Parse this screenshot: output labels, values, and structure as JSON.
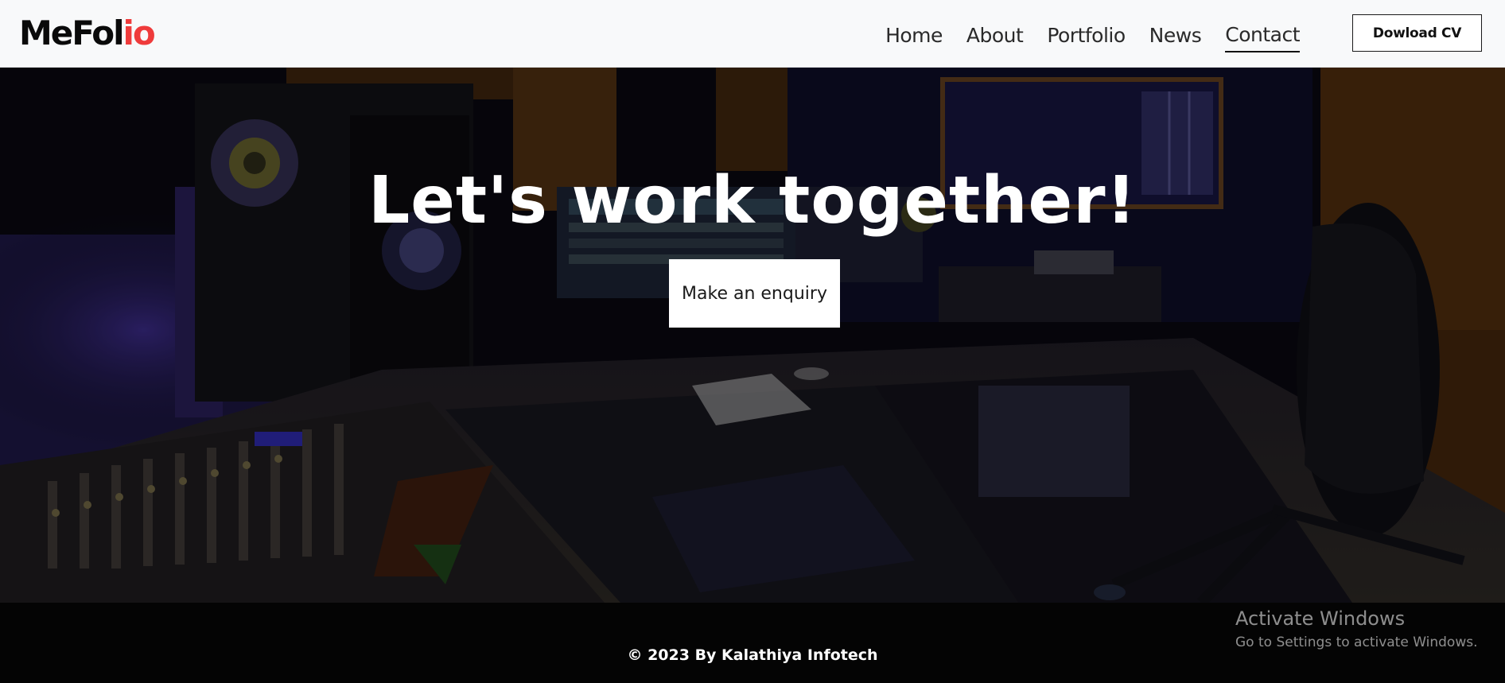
{
  "brand": {
    "logo_main": "MeFol",
    "logo_accent": "io",
    "accent_color": "#ef3b3b"
  },
  "nav": {
    "items": [
      {
        "label": "Home"
      },
      {
        "label": "About"
      },
      {
        "label": "Portfolio"
      },
      {
        "label": "News"
      },
      {
        "label": "Contact",
        "active": true
      }
    ],
    "cv_button_label": "Dowload CV"
  },
  "hero": {
    "title": "Let's work together!",
    "cta_label": "Make an enquiry",
    "background_image": "dark music recording studio with mixing console and speaker monitors"
  },
  "footer": {
    "copyright": "© 2023 By Kalathiya Infotech"
  },
  "os_watermark": {
    "title": "Activate Windows",
    "subtitle": "Go to Settings to activate Windows."
  }
}
